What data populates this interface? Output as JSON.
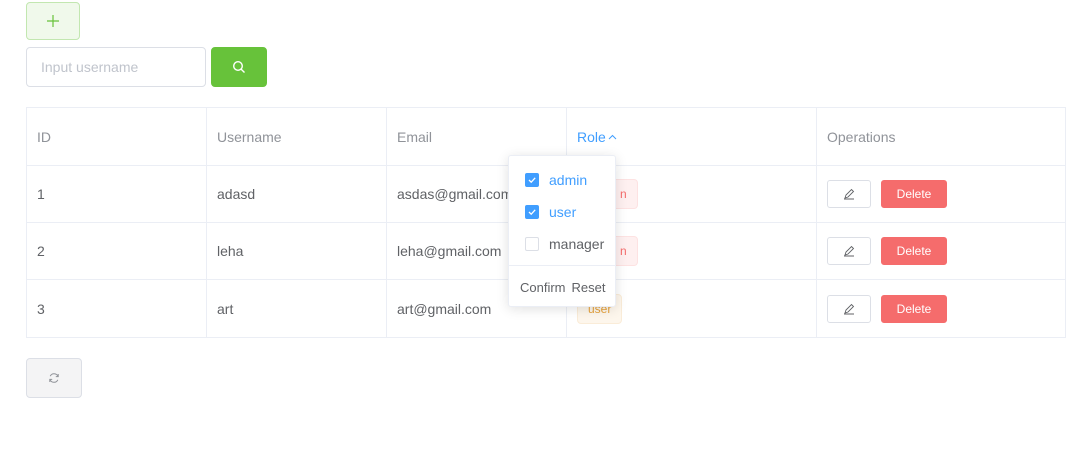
{
  "toolbar": {
    "add_icon": "plus-icon",
    "search_icon": "search-icon"
  },
  "search": {
    "placeholder": "Input username",
    "value": ""
  },
  "table": {
    "headers": {
      "id": "ID",
      "username": "Username",
      "email": "Email",
      "role": "Role",
      "operations": "Operations"
    },
    "rows": [
      {
        "id": "1",
        "username": "adasd",
        "email": "asdas@gmail.com",
        "role_partial": "n"
      },
      {
        "id": "2",
        "username": "leha",
        "email": "leha@gmail.com",
        "role_partial": "n"
      },
      {
        "id": "3",
        "username": "art",
        "email": "art@gmail.com",
        "role": "user"
      }
    ],
    "delete_label": "Delete",
    "edit_icon": "edit-icon"
  },
  "role_filter": {
    "options": [
      {
        "label": "admin",
        "checked": true
      },
      {
        "label": "user",
        "checked": true
      },
      {
        "label": "manager",
        "checked": false
      }
    ],
    "confirm_label": "Confirm",
    "reset_label": "Reset"
  },
  "refresh_icon": "refresh-icon",
  "colors": {
    "primary": "#409eff",
    "success": "#67c23a",
    "danger": "#f56c6c",
    "warning": "#e6a23c"
  }
}
